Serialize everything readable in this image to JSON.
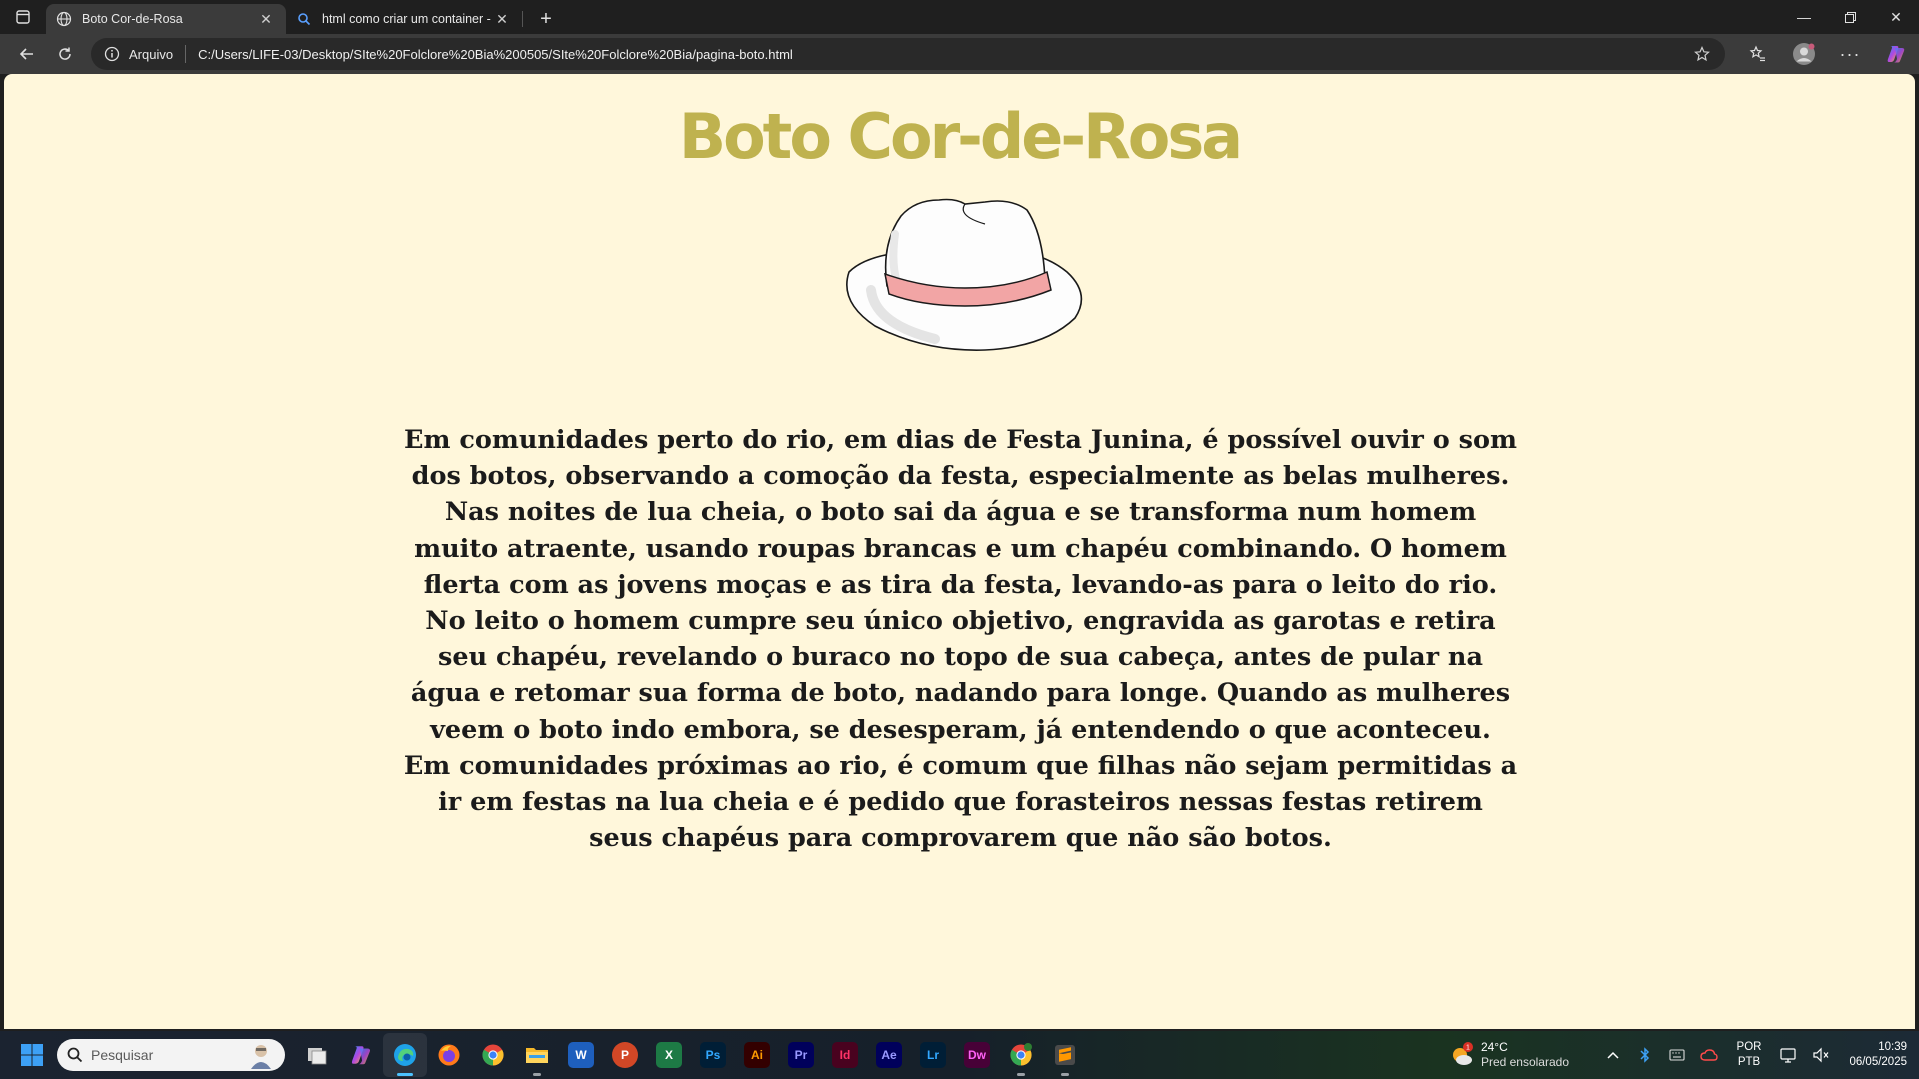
{
  "browser": {
    "tabs": [
      {
        "title": "Boto Cor-de-Rosa",
        "active": true
      },
      {
        "title": "html como criar um container - P",
        "active": false
      }
    ],
    "address": {
      "scheme_label": "Arquivo",
      "url": "C:/Users/LIFE-03/Desktop/SIte%20Folclore%20Bia%200505/SIte%20Folclore%20Bia/pagina-boto.html"
    }
  },
  "page": {
    "title": "Boto Cor-de-Rosa",
    "body": "Em comunidades perto do rio, em dias de Festa Junina, é possível ouvir o som dos botos, observando a comoção da festa, especialmente as belas mulheres. Nas noites de lua cheia, o boto sai da água e se transforma num homem muito atraente, usando roupas brancas e um chapéu combinando. O homem flerta com as jovens moças e as tira da festa, levando-as para o leito do rio. No leito o homem cumpre seu único objetivo, engravida as garotas e retira seu chapéu, revelando o buraco no topo de sua cabeça, antes de pular na água e retomar sua forma de boto, nadando para longe. Quando as mulheres veem o boto indo embora, se desesperam, já entendendo o que aconteceu. Em comunidades próximas ao rio, é comum que filhas não sejam permitidas a ir em festas na lua cheia e é pedido que forasteiros nessas festas retirem seus chapéus para comprovarem que não são botos.",
    "colors": {
      "background": "#fff7db",
      "title": "#bfb24f",
      "text": "#1b1b1b",
      "hat_band": "#f2a5a5"
    }
  },
  "taskbar": {
    "search_placeholder": "Pesquisar",
    "apps": [
      "task-view",
      "copilot",
      "edge",
      "firefox",
      "chrome",
      "file-explorer",
      "word",
      "powerpoint",
      "excel",
      "photoshop",
      "illustrator",
      "premiere",
      "indesign",
      "after-effects",
      "lightroom",
      "dreamweaver",
      "chrome-profile",
      "sublime-text"
    ],
    "app_labels": {
      "word": "W",
      "powerpoint": "P",
      "excel": "X",
      "photoshop": "Ps",
      "illustrator": "Ai",
      "premiere": "Pr",
      "indesign": "Id",
      "after_effects": "Ae",
      "lightroom": "Lr",
      "dreamweaver": "Dw"
    },
    "weather": {
      "temp": "24°C",
      "desc": "Pred ensolarado",
      "badge": "1"
    },
    "language": {
      "lang": "POR",
      "layout": "PTB"
    },
    "clock": {
      "time": "10:39",
      "date": "06/05/2025"
    }
  }
}
